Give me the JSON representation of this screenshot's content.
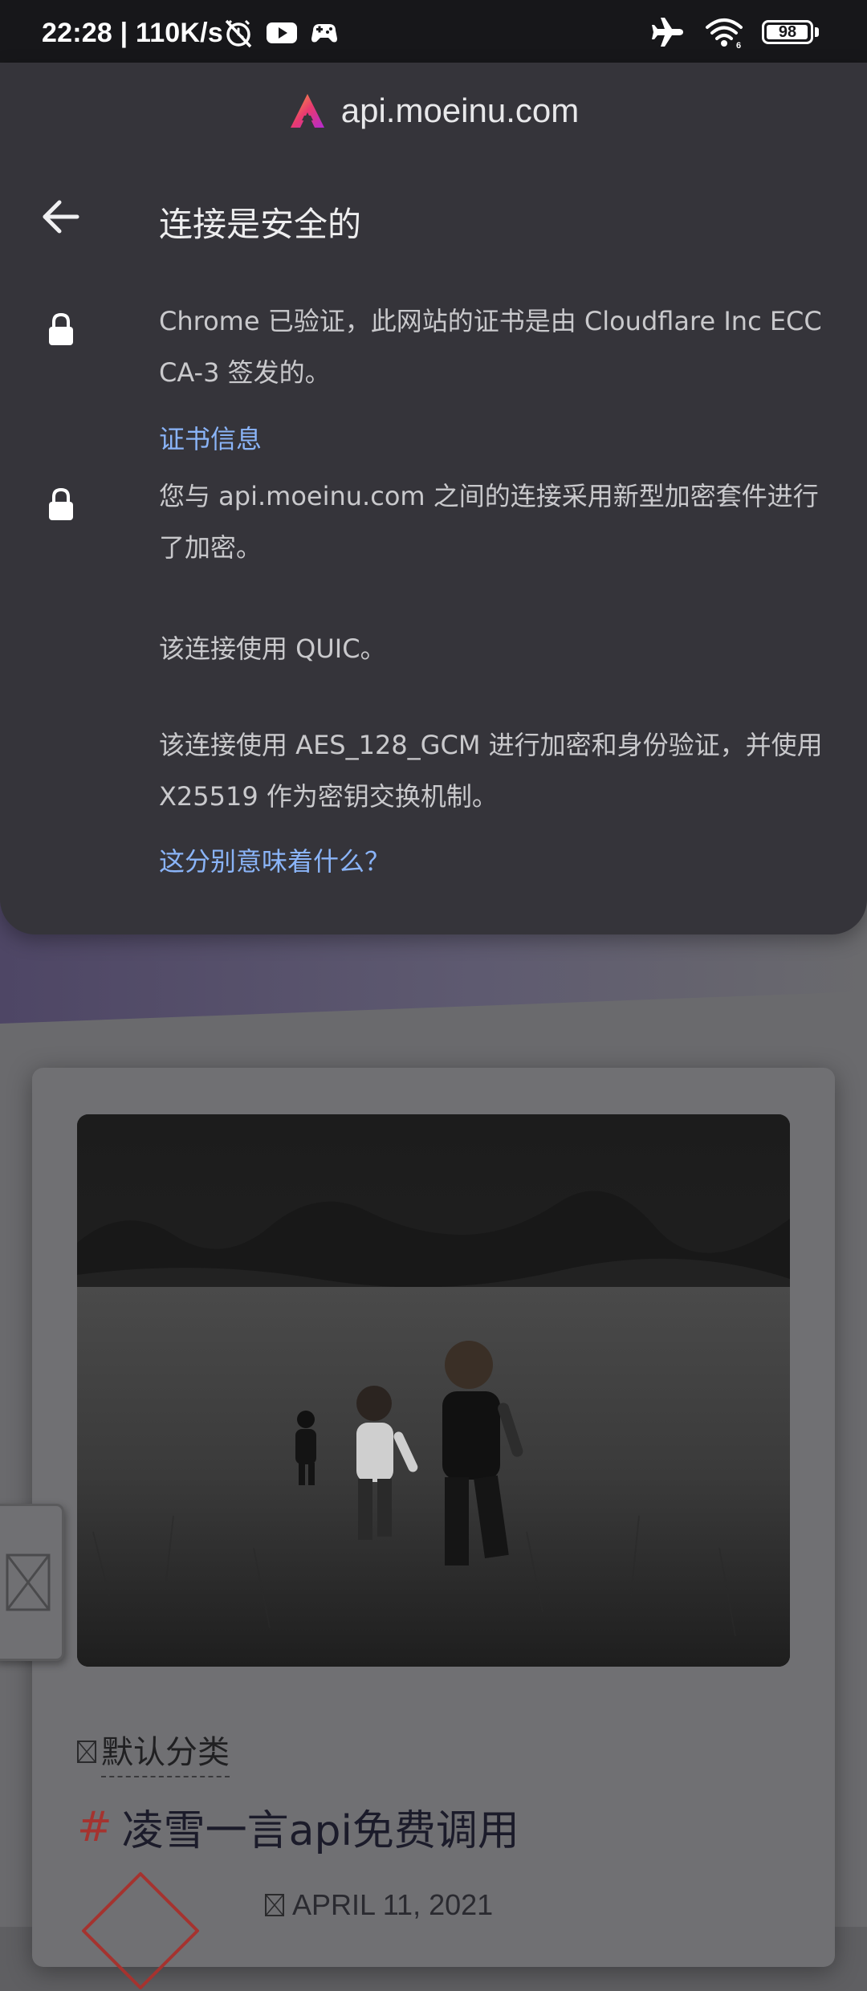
{
  "status_bar": {
    "time_speed": "22:28 | 110K/s",
    "battery": "98"
  },
  "sheet": {
    "site_host": "api.moeinu.com",
    "title": "连接是安全的",
    "cert_text": "Chrome 已验证，此网站的证书是由 Cloudflare Inc ECC CA-3 签发的。",
    "cert_link": "证书信息",
    "encryption_text": "您与 api.moeinu.com 之间的连接采用新型加密套件进行了加密。",
    "quic_text": "该连接使用 QUIC。",
    "cipher_text": "该连接使用 AES_128_GCM 进行加密和身份验证，并使用 X25519 作为密钥交换机制。",
    "meaning_link": "这分别意味着什么？"
  },
  "background_page": {
    "category": "默认分类",
    "post_title": "凌雪一言api免费调用",
    "post_date": "APRIL 11, 2021"
  },
  "colors": {
    "sheet_bg": "#35343a",
    "link": "#8ab4f8",
    "hash": "#a5332f"
  }
}
